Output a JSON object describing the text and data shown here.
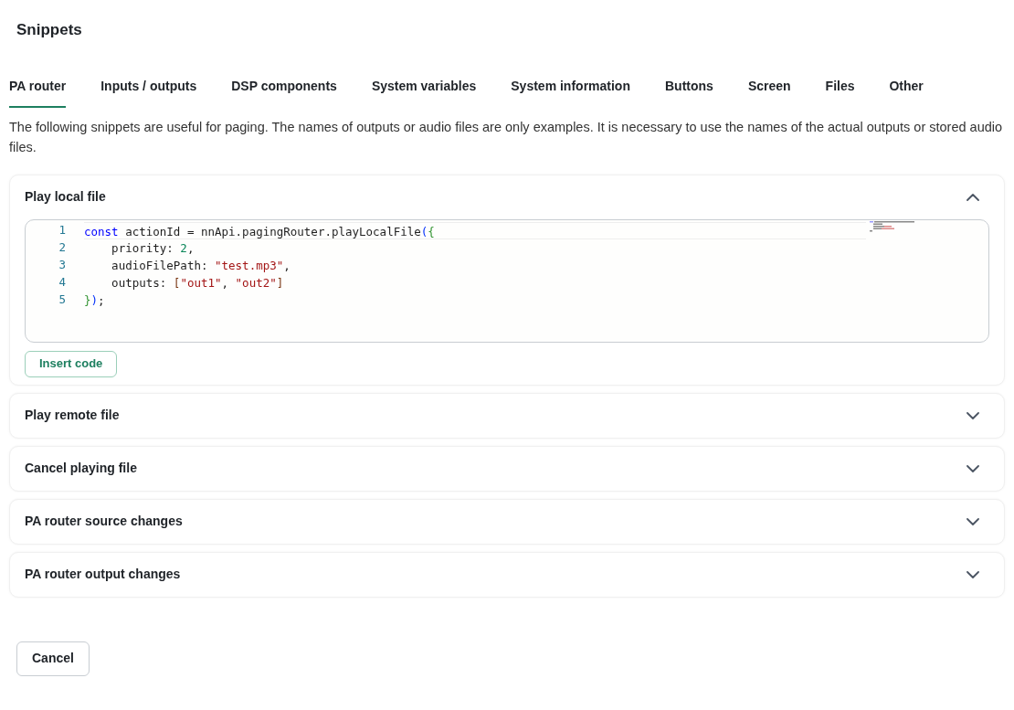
{
  "title": "Snippets",
  "tabs": [
    {
      "label": "PA router",
      "selected": true
    },
    {
      "label": "Inputs / outputs",
      "selected": false
    },
    {
      "label": "DSP components",
      "selected": false
    },
    {
      "label": "System variables",
      "selected": false
    },
    {
      "label": "System information",
      "selected": false
    },
    {
      "label": "Buttons",
      "selected": false
    },
    {
      "label": "Screen",
      "selected": false
    },
    {
      "label": "Files",
      "selected": false
    },
    {
      "label": "Other",
      "selected": false
    }
  ],
  "description": "The following snippets are useful for paging. The names of outputs or audio files are only examples. It is necessary to use the names of the actual outputs or stored audio files.",
  "sections": [
    {
      "title": "Play local file",
      "expanded": true,
      "code": [
        {
          "number": "1",
          "tokens": [
            {
              "kind": "keyword",
              "text": "const"
            },
            {
              "kind": "plain",
              "text": " actionId = nnApi.pagingRouter.playLocalFile"
            },
            {
              "kind": "bracket2",
              "text": "("
            },
            {
              "kind": "bracket1",
              "text": "{"
            }
          ]
        },
        {
          "number": "2",
          "tokens": [
            {
              "kind": "plain",
              "text": "    priority: "
            },
            {
              "kind": "number",
              "text": "2"
            },
            {
              "kind": "plain",
              "text": ","
            }
          ]
        },
        {
          "number": "3",
          "tokens": [
            {
              "kind": "plain",
              "text": "    audioFilePath: "
            },
            {
              "kind": "string",
              "text": "\"test.mp3\""
            },
            {
              "kind": "plain",
              "text": ","
            }
          ]
        },
        {
          "number": "4",
          "tokens": [
            {
              "kind": "plain",
              "text": "    outputs: "
            },
            {
              "kind": "bracket3",
              "text": "["
            },
            {
              "kind": "string",
              "text": "\"out1\""
            },
            {
              "kind": "plain",
              "text": ", "
            },
            {
              "kind": "string",
              "text": "\"out2\""
            },
            {
              "kind": "bracket3",
              "text": "]"
            }
          ]
        },
        {
          "number": "5",
          "tokens": [
            {
              "kind": "bracket1",
              "text": "}"
            },
            {
              "kind": "bracket2",
              "text": ")"
            },
            {
              "kind": "plain",
              "text": ";"
            }
          ]
        }
      ],
      "button": "Insert code"
    },
    {
      "title": "Play remote file",
      "expanded": false
    },
    {
      "title": "Cancel playing file",
      "expanded": false
    },
    {
      "title": "PA router source changes",
      "expanded": false
    },
    {
      "title": "PA router output changes",
      "expanded": false
    }
  ],
  "cancel": "Cancel"
}
